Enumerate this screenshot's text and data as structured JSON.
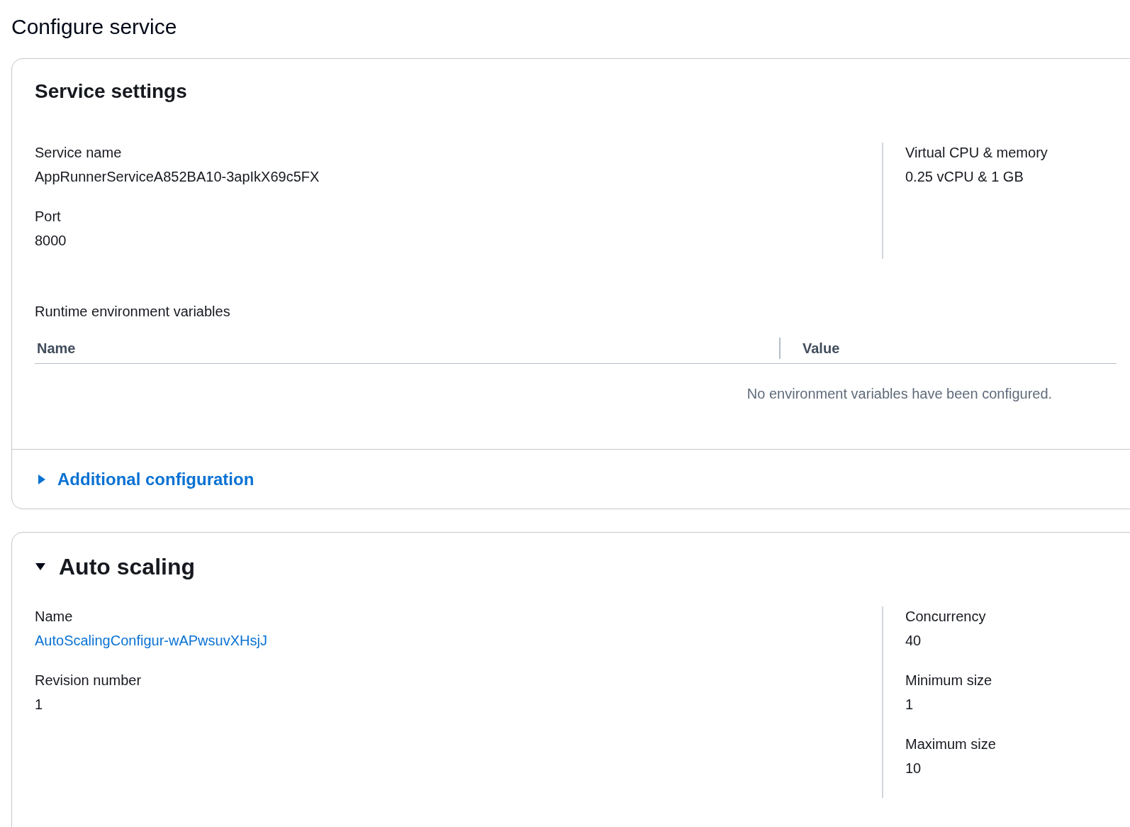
{
  "page_title": "Configure service",
  "service_settings": {
    "title": "Service settings",
    "left_fields": [
      {
        "label": "Service name",
        "value": "AppRunnerServiceA852BA10-3apIkX69c5FX"
      },
      {
        "label": "Port",
        "value": "8000"
      }
    ],
    "right_fields": [
      {
        "label": "Virtual CPU & memory",
        "value": "0.25 vCPU & 1 GB"
      }
    ],
    "env_vars": {
      "title": "Runtime environment variables",
      "columns": [
        "Name",
        "Value"
      ],
      "empty_message": "No environment variables have been configured."
    },
    "additional_configuration": {
      "label": "Additional configuration",
      "expanded": false
    }
  },
  "auto_scaling": {
    "title": "Auto scaling",
    "expanded": true,
    "left_fields": [
      {
        "label": "Name",
        "value": "AutoScalingConfigur-wAPwsuvXHsjJ",
        "kind": "link"
      },
      {
        "label": "Revision number",
        "value": "1"
      }
    ],
    "right_fields": [
      {
        "label": "Concurrency",
        "value": "40"
      },
      {
        "label": "Minimum size",
        "value": "1"
      },
      {
        "label": "Maximum size",
        "value": "10"
      }
    ]
  }
}
